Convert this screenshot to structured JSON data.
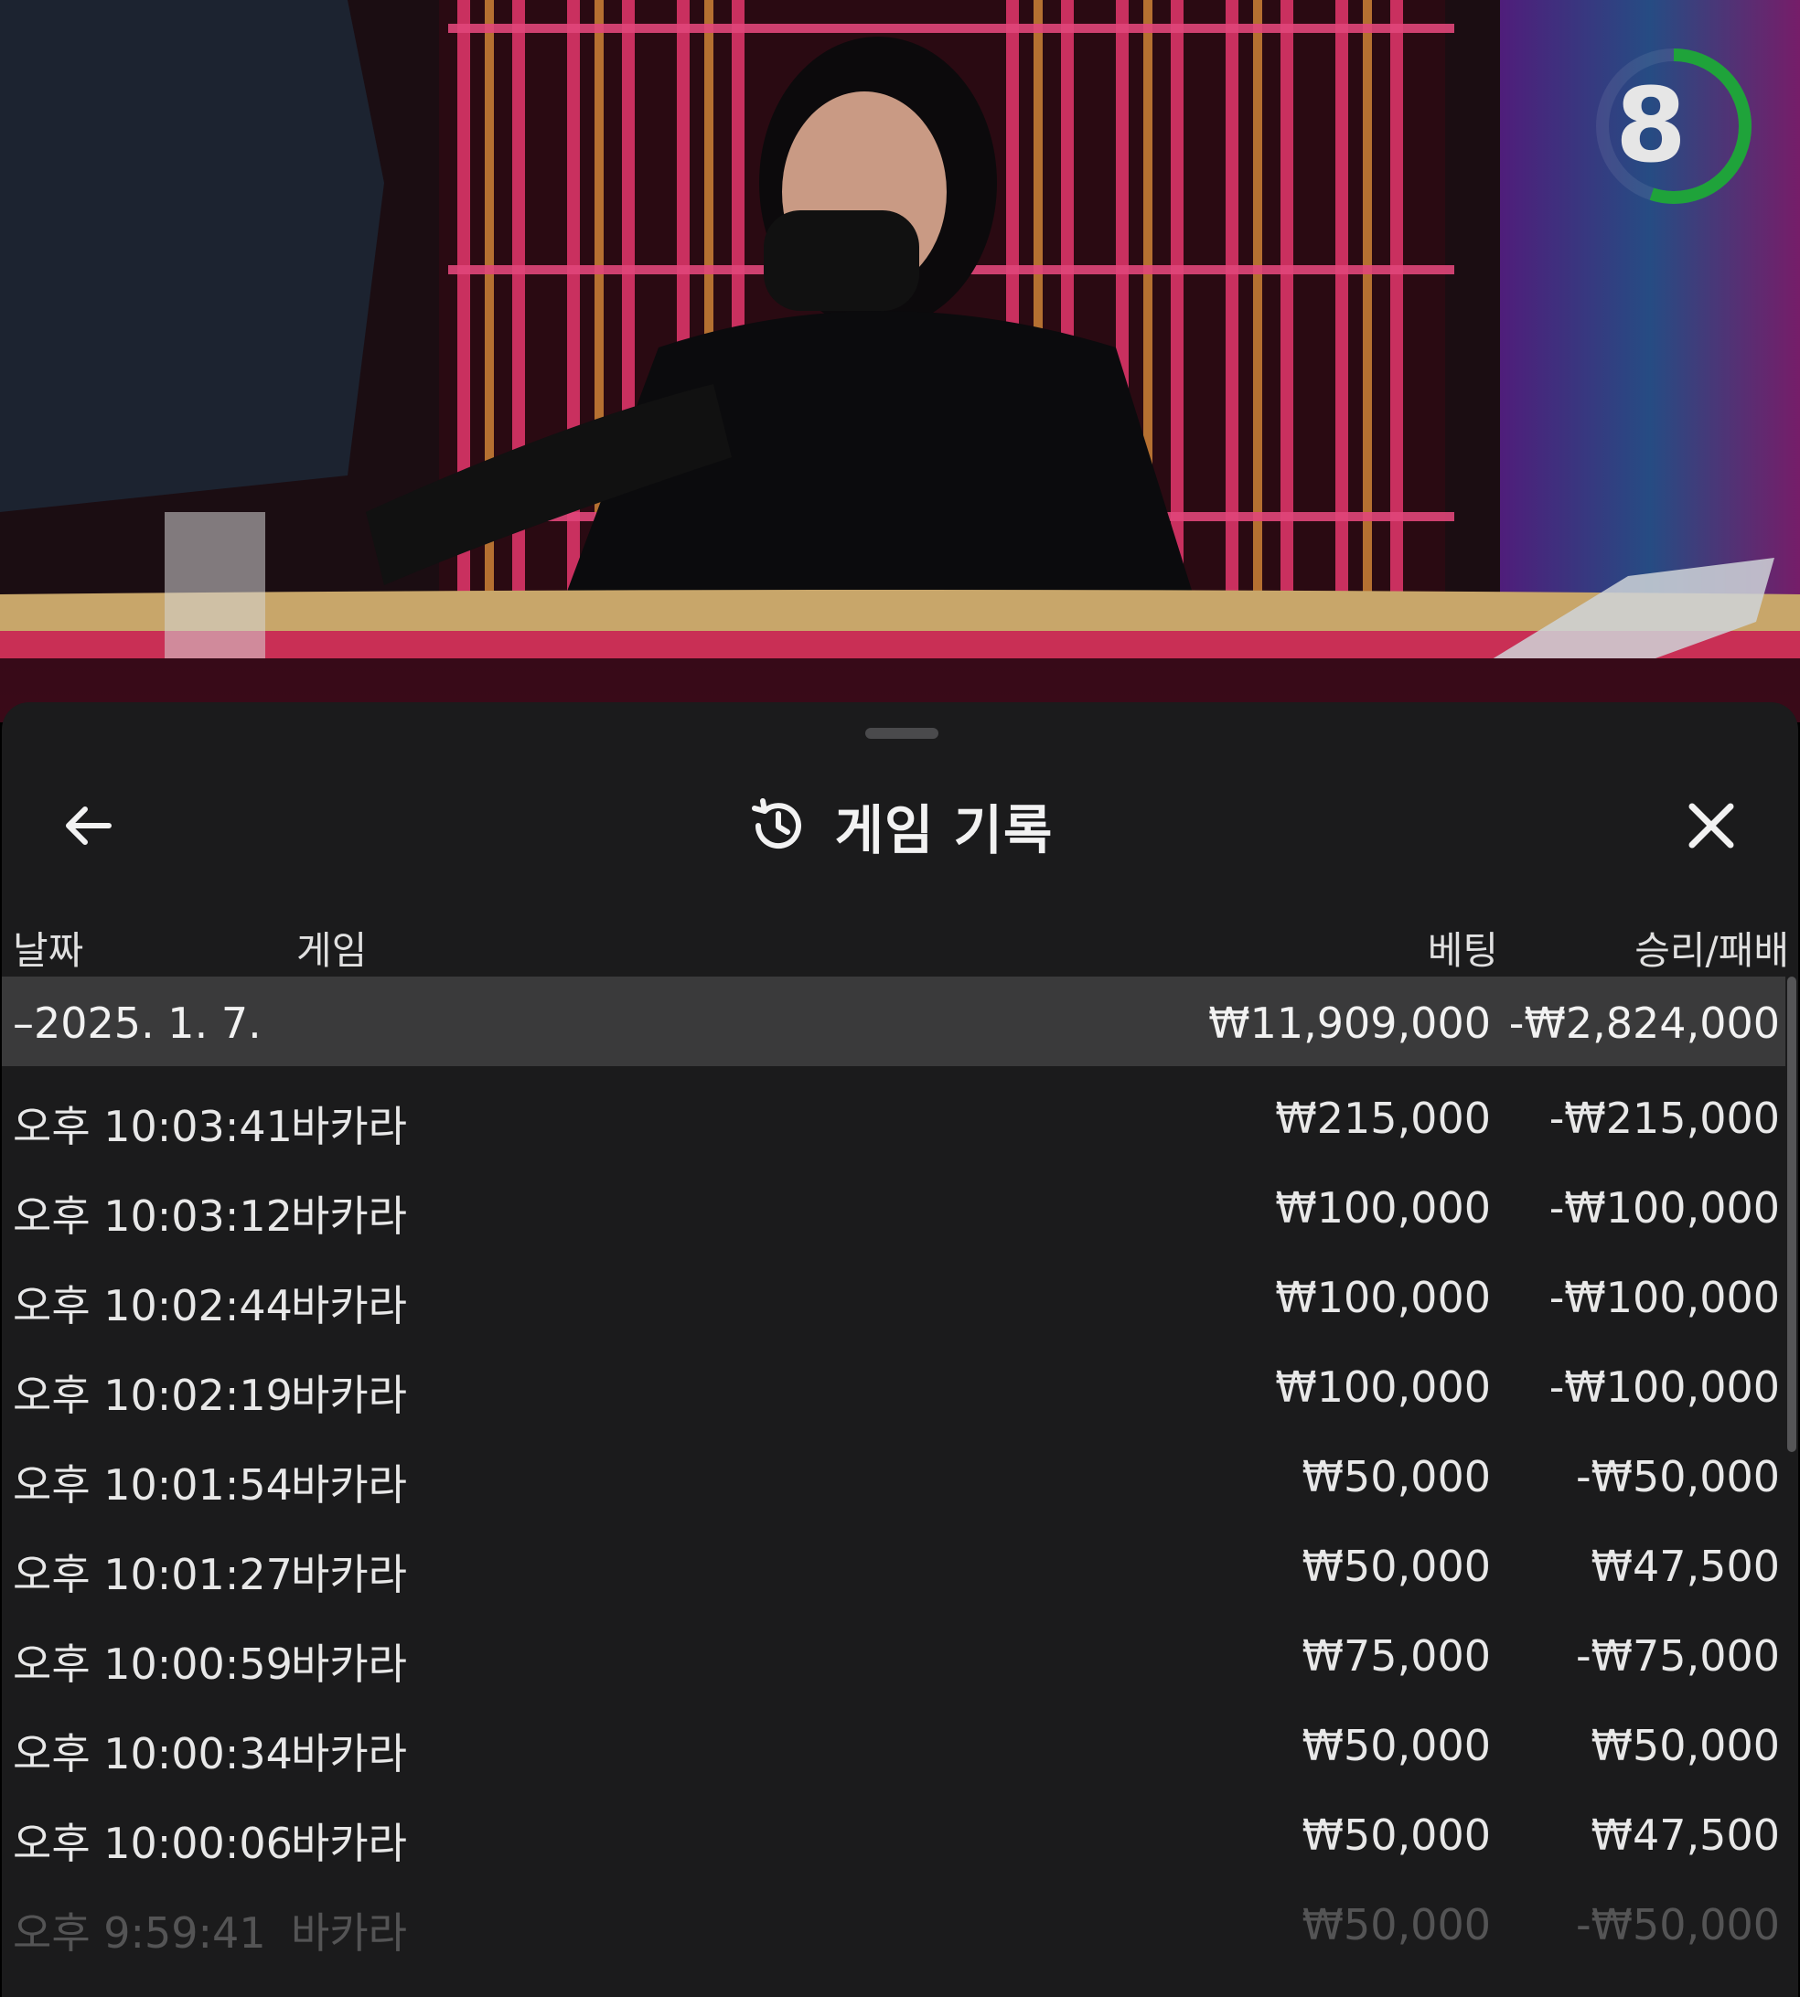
{
  "countdown": {
    "value": "8",
    "progress": 0.55,
    "ring_color": "#1fa33a"
  },
  "sheet": {
    "title": "게임 기록",
    "title_icon": "history-icon",
    "back_icon": "arrow-left-icon",
    "close_icon": "close-icon"
  },
  "columns": {
    "date": "날짜",
    "game": "게임",
    "bet": "베팅",
    "win_loss": "승리/패배"
  },
  "group": {
    "date": "–2025. 1. 7.",
    "total_bet": "₩11,909,000",
    "total_win_loss": "-₩2,824,000"
  },
  "rows": [
    {
      "time": "오후 10:03:41",
      "game": "바카라",
      "bet": "₩215,000",
      "win_loss": "-₩215,000"
    },
    {
      "time": "오후 10:03:12",
      "game": "바카라",
      "bet": "₩100,000",
      "win_loss": "-₩100,000"
    },
    {
      "time": "오후 10:02:44",
      "game": "바카라",
      "bet": "₩100,000",
      "win_loss": "-₩100,000"
    },
    {
      "time": "오후 10:02:19",
      "game": "바카라",
      "bet": "₩100,000",
      "win_loss": "-₩100,000"
    },
    {
      "time": "오후 10:01:54",
      "game": "바카라",
      "bet": "₩50,000",
      "win_loss": "-₩50,000"
    },
    {
      "time": "오후 10:01:27",
      "game": "바카라",
      "bet": "₩50,000",
      "win_loss": "₩47,500"
    },
    {
      "time": "오후 10:00:59",
      "game": "바카라",
      "bet": "₩75,000",
      "win_loss": "-₩75,000"
    },
    {
      "time": "오후 10:00:34",
      "game": "바카라",
      "bet": "₩50,000",
      "win_loss": "₩50,000"
    },
    {
      "time": "오후 10:00:06",
      "game": "바카라",
      "bet": "₩50,000",
      "win_loss": "₩47,500"
    },
    {
      "time": "오후 9:59:41",
      "game": "바카라",
      "bet": "₩50,000",
      "win_loss": "-₩50,000"
    }
  ]
}
